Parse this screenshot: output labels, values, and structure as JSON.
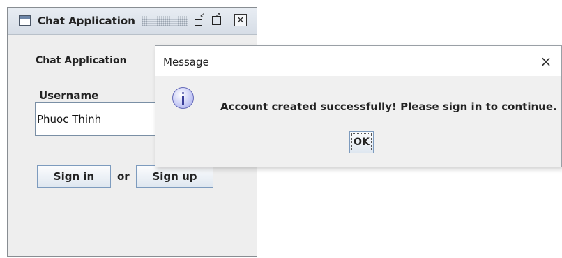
{
  "main_window": {
    "title": "Chat Application",
    "group_title": "Chat Application",
    "username_label": "Username",
    "username_value": "Phuoc Thinh",
    "signin_label": "Sign in",
    "or_label": "or",
    "signup_label": "Sign up",
    "icons": [
      "window-icon",
      "minimize-icon",
      "maximize-icon",
      "close-icon"
    ]
  },
  "dialog": {
    "title": "Message",
    "close_glyph": "×",
    "message": "Account created successfully! Please sign in to continue.",
    "ok_label": "OK",
    "icon": "info-icon"
  }
}
